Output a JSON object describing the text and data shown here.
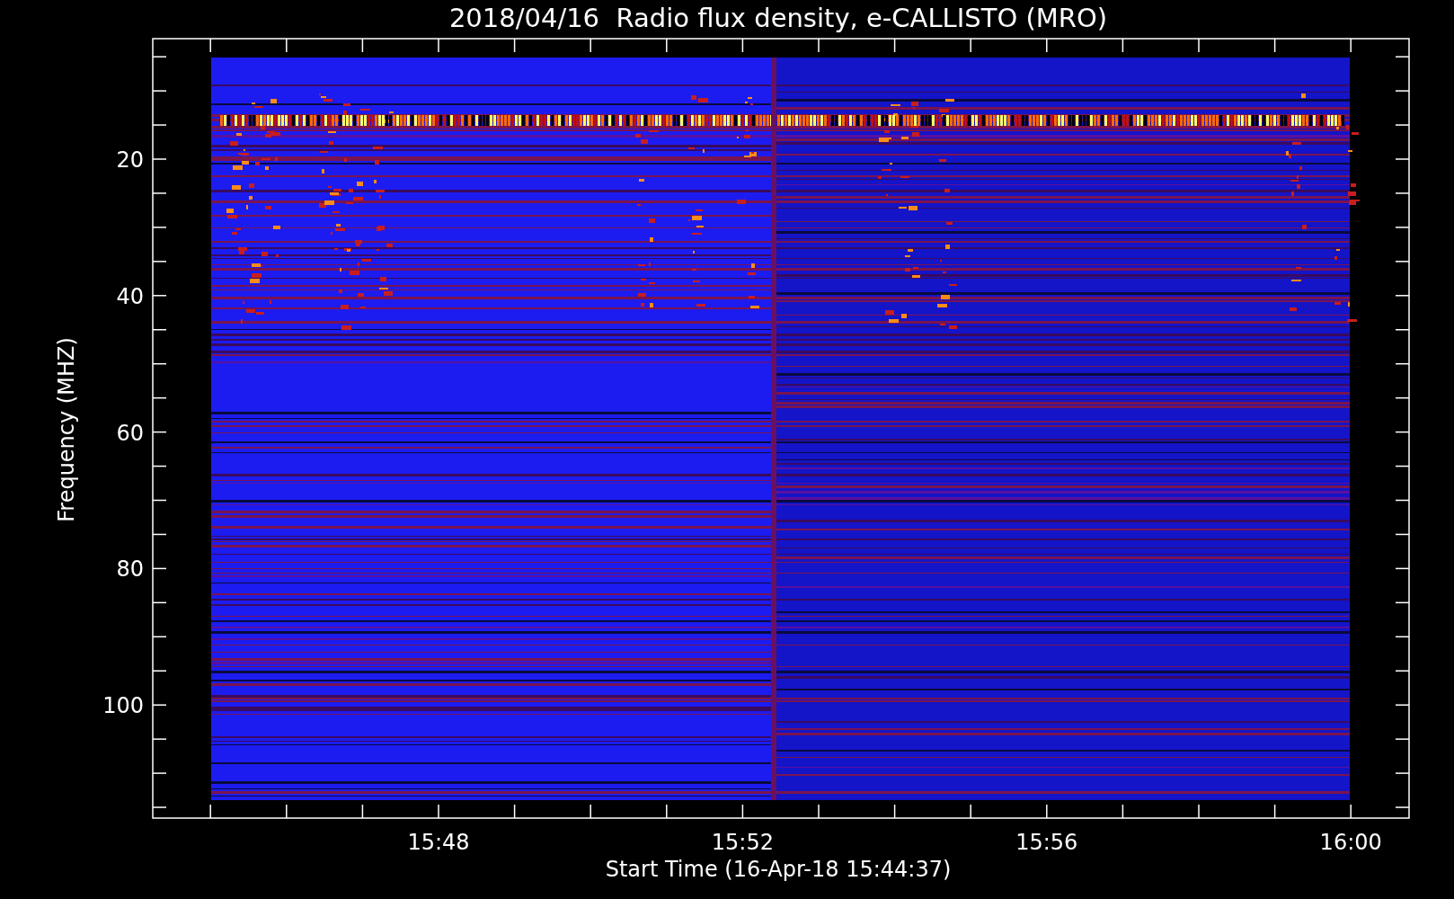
{
  "plot": {
    "title": "2018/04/16  Radio flux density, e-CALLISTO (MRO)",
    "y_axis": {
      "label": "Frequency (MHZ)",
      "ticks": [
        "20",
        "40",
        "60",
        "80",
        "100"
      ]
    },
    "x_axis": {
      "label": "Start Time (16-Apr-18 15:44:37)",
      "ticks": [
        "15:48",
        "15:52",
        "15:56",
        "16:00"
      ]
    }
  }
}
